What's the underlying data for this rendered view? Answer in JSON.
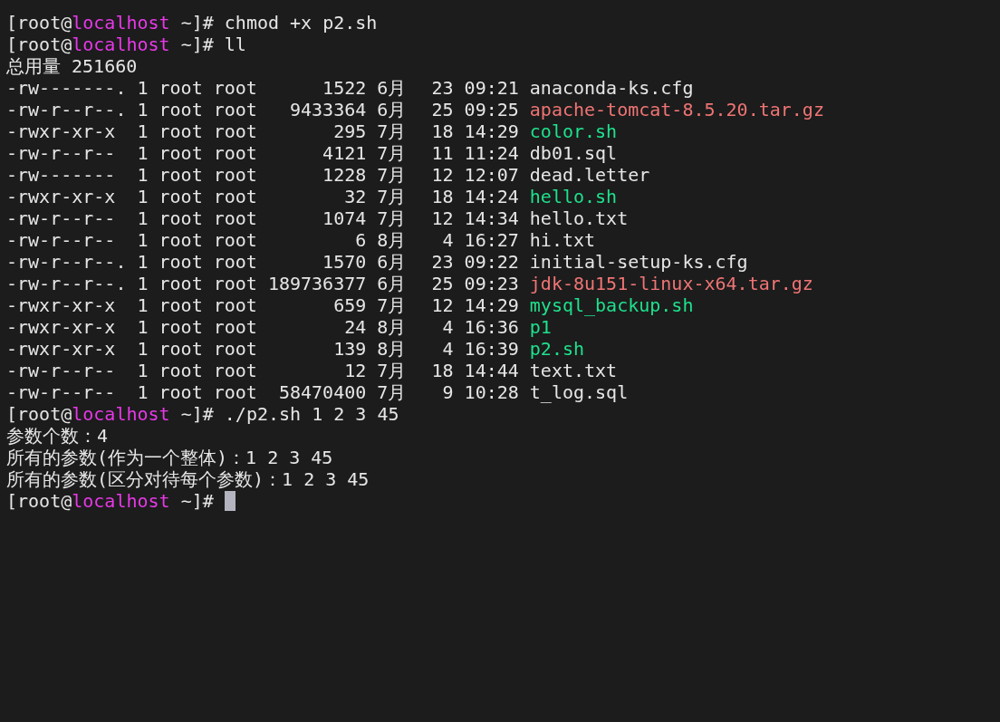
{
  "terminal": {
    "lines": [
      {
        "kind": "prompt",
        "prefix": "[root@",
        "host": "localhost",
        "suffix": " ~]#",
        "command": "chmod +x p2.sh",
        "cursor": false
      },
      {
        "kind": "prompt",
        "prefix": "[root@",
        "host": "localhost",
        "suffix": " ~]#",
        "command": "ll",
        "cursor": false
      },
      {
        "kind": "output",
        "text": "总用量 251660"
      },
      {
        "kind": "entry",
        "perms": "-rw-------.",
        "links": "1",
        "owner": "root",
        "group": "root",
        "size": "1522",
        "month": "6月",
        "day": "23",
        "time": "09:21",
        "name": "anaconda-ks.cfg",
        "color": "#e6e6e6"
      },
      {
        "kind": "entry",
        "perms": "-rw-r--r--.",
        "links": "1",
        "owner": "root",
        "group": "root",
        "size": "9433364",
        "month": "6月",
        "day": "25",
        "time": "09:25",
        "name": "apache-tomcat-8.5.20.tar.gz",
        "color": "#f07474"
      },
      {
        "kind": "entry",
        "perms": "-rwxr-xr-x",
        "links": "1",
        "owner": "root",
        "group": "root",
        "size": "295",
        "month": "7月",
        "day": "18",
        "time": "14:29",
        "name": "color.sh",
        "color": "#1fe08c"
      },
      {
        "kind": "entry",
        "perms": "-rw-r--r--",
        "links": "1",
        "owner": "root",
        "group": "root",
        "size": "4121",
        "month": "7月",
        "day": "11",
        "time": "11:24",
        "name": "db01.sql",
        "color": "#e6e6e6"
      },
      {
        "kind": "entry",
        "perms": "-rw-------",
        "links": "1",
        "owner": "root",
        "group": "root",
        "size": "1228",
        "month": "7月",
        "day": "12",
        "time": "12:07",
        "name": "dead.letter",
        "color": "#e6e6e6"
      },
      {
        "kind": "entry",
        "perms": "-rwxr-xr-x",
        "links": "1",
        "owner": "root",
        "group": "root",
        "size": "32",
        "month": "7月",
        "day": "18",
        "time": "14:24",
        "name": "hello.sh",
        "color": "#1fe08c"
      },
      {
        "kind": "entry",
        "perms": "-rw-r--r--",
        "links": "1",
        "owner": "root",
        "group": "root",
        "size": "1074",
        "month": "7月",
        "day": "12",
        "time": "14:34",
        "name": "hello.txt",
        "color": "#e6e6e6"
      },
      {
        "kind": "entry",
        "perms": "-rw-r--r--",
        "links": "1",
        "owner": "root",
        "group": "root",
        "size": "6",
        "month": "8月",
        "day": "4",
        "time": "16:27",
        "name": "hi.txt",
        "color": "#e6e6e6"
      },
      {
        "kind": "entry",
        "perms": "-rw-r--r--.",
        "links": "1",
        "owner": "root",
        "group": "root",
        "size": "1570",
        "month": "6月",
        "day": "23",
        "time": "09:22",
        "name": "initial-setup-ks.cfg",
        "color": "#e6e6e6"
      },
      {
        "kind": "entry",
        "perms": "-rw-r--r--.",
        "links": "1",
        "owner": "root",
        "group": "root",
        "size": "189736377",
        "month": "6月",
        "day": "25",
        "time": "09:23",
        "name": "jdk-8u151-linux-x64.tar.gz",
        "color": "#f07474"
      },
      {
        "kind": "entry",
        "perms": "-rwxr-xr-x",
        "links": "1",
        "owner": "root",
        "group": "root",
        "size": "659",
        "month": "7月",
        "day": "12",
        "time": "14:29",
        "name": "mysql_backup.sh",
        "color": "#1fe08c"
      },
      {
        "kind": "entry",
        "perms": "-rwxr-xr-x",
        "links": "1",
        "owner": "root",
        "group": "root",
        "size": "24",
        "month": "8月",
        "day": "4",
        "time": "16:36",
        "name": "p1",
        "color": "#1fe08c"
      },
      {
        "kind": "entry",
        "perms": "-rwxr-xr-x",
        "links": "1",
        "owner": "root",
        "group": "root",
        "size": "139",
        "month": "8月",
        "day": "4",
        "time": "16:39",
        "name": "p2.sh",
        "color": "#1fe08c"
      },
      {
        "kind": "entry",
        "perms": "-rw-r--r--",
        "links": "1",
        "owner": "root",
        "group": "root",
        "size": "12",
        "month": "7月",
        "day": "18",
        "time": "14:44",
        "name": "text.txt",
        "color": "#e6e6e6"
      },
      {
        "kind": "entry",
        "perms": "-rw-r--r--",
        "links": "1",
        "owner": "root",
        "group": "root",
        "size": "58470400",
        "month": "7月",
        "day": "9",
        "time": "10:28",
        "name": "t_log.sql",
        "color": "#e6e6e6"
      },
      {
        "kind": "prompt",
        "prefix": "[root@",
        "host": "localhost",
        "suffix": " ~]#",
        "command": "./p2.sh 1 2 3 45",
        "cursor": false
      },
      {
        "kind": "output",
        "text": "参数个数：4"
      },
      {
        "kind": "output",
        "text": "所有的参数(作为一个整体)：1 2 3 45"
      },
      {
        "kind": "output",
        "text": "所有的参数(区分对待每个参数)：1 2 3 45"
      },
      {
        "kind": "prompt",
        "prefix": "[root@",
        "host": "localhost",
        "suffix": " ~]#",
        "cursor": true
      }
    ]
  }
}
